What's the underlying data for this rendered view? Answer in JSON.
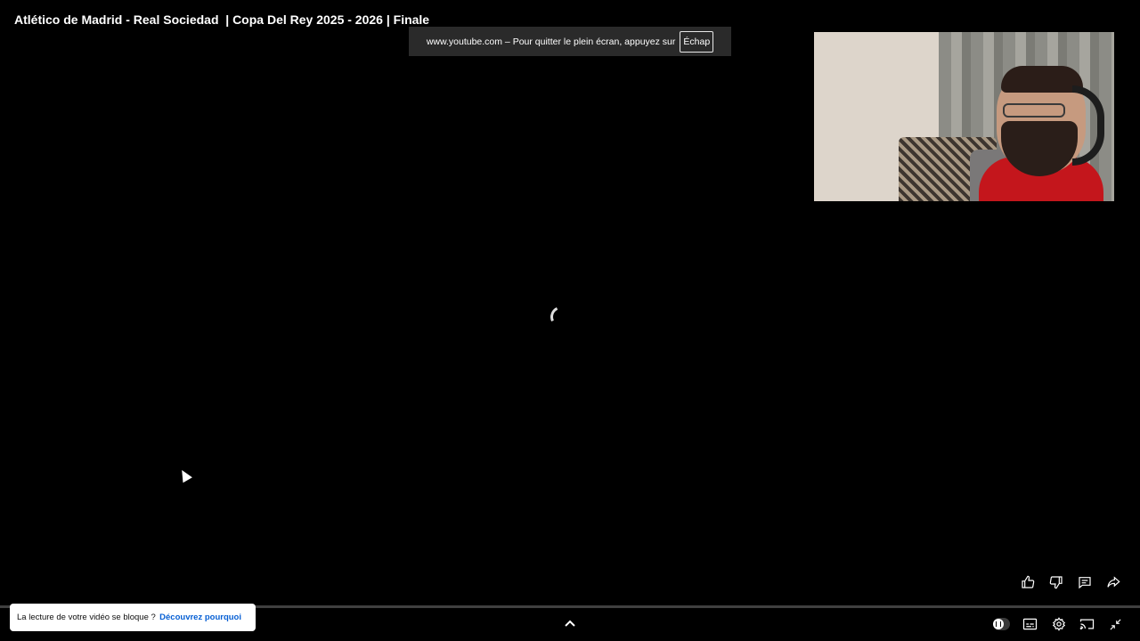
{
  "video": {
    "title": "Atlético de Madrid - Real Sociedad  | Copa Del Rey 2025 - 2026 | Finale"
  },
  "fullscreen_banner": {
    "message": "www.youtube.com – Pour quitter le plein écran, appuyez sur",
    "key": "Échap"
  },
  "notice": {
    "text": "La lecture de votre vidéo se bloque ?",
    "link": "Découvrez pourquoi"
  },
  "actions": [
    "like-icon",
    "dislike-icon",
    "comment-icon",
    "share-icon"
  ],
  "controls": [
    "autoplay-toggle",
    "subtitles-icon",
    "settings-icon",
    "cast-icon",
    "exit-fullscreen-icon"
  ],
  "colors": {
    "background": "#000000",
    "link": "#065fd4",
    "banner": "#2a2a2a"
  }
}
